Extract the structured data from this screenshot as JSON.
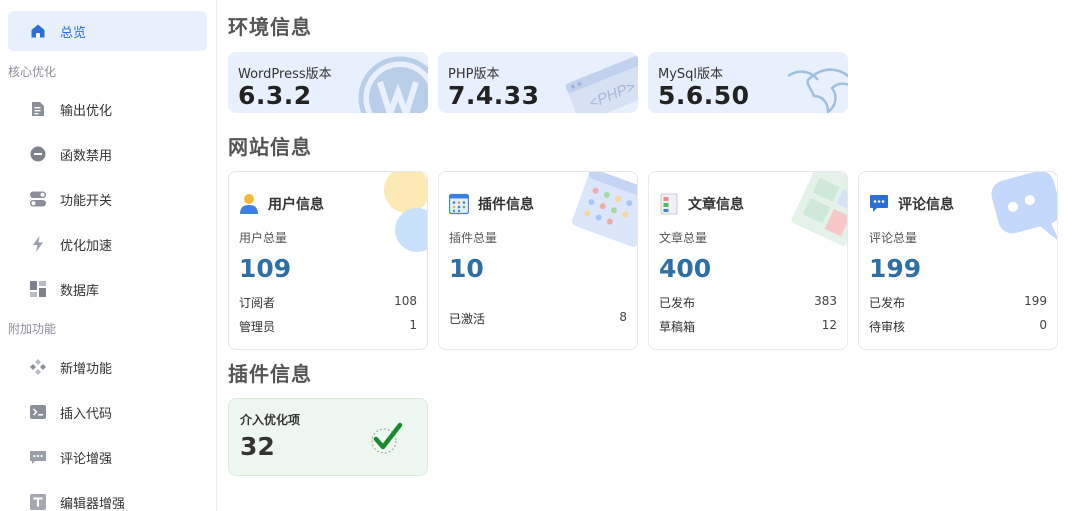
{
  "sidebar": {
    "active": {
      "label": "总览",
      "icon": "home-icon"
    },
    "groups": [
      {
        "title": "核心优化",
        "items": [
          {
            "label": "输出优化",
            "icon": "document-icon"
          },
          {
            "label": "函数禁用",
            "icon": "minus-circle-icon"
          },
          {
            "label": "功能开关",
            "icon": "toggle-icon"
          },
          {
            "label": "优化加速",
            "icon": "lightning-icon"
          },
          {
            "label": "数据库",
            "icon": "database-grid-icon"
          }
        ]
      },
      {
        "title": "附加功能",
        "items": [
          {
            "label": "新增功能",
            "icon": "diamond-icon"
          },
          {
            "label": "插入代码",
            "icon": "terminal-icon"
          },
          {
            "label": "评论增强",
            "icon": "comment-dots-icon"
          },
          {
            "label": "编辑器增强",
            "icon": "text-t-icon"
          }
        ]
      }
    ]
  },
  "env": {
    "title": "环境信息",
    "cards": [
      {
        "name": "WordPress版本",
        "version": "6.3.2",
        "icon": "wordpress-logo-icon"
      },
      {
        "name": "PHP版本",
        "version": "7.4.33",
        "icon": "php-logo-icon"
      },
      {
        "name": "MySql版本",
        "version": "5.6.50",
        "icon": "mysql-dolphin-icon"
      }
    ]
  },
  "site": {
    "title": "网站信息",
    "cards": [
      {
        "title": "用户信息",
        "subtitle": "用户总量",
        "total": "109",
        "rows": [
          {
            "label": "订阅者",
            "value": "108"
          },
          {
            "label": "管理员",
            "value": "1"
          }
        ]
      },
      {
        "title": "插件信息",
        "subtitle": "插件总量",
        "total": "10",
        "rows": [
          {
            "label": "已激活",
            "value": "8"
          }
        ]
      },
      {
        "title": "文章信息",
        "subtitle": "文章总量",
        "total": "400",
        "rows": [
          {
            "label": "已发布",
            "value": "383"
          },
          {
            "label": "草稿箱",
            "value": "12"
          }
        ]
      },
      {
        "title": "评论信息",
        "subtitle": "评论总量",
        "total": "199",
        "rows": [
          {
            "label": "已发布",
            "value": "199"
          },
          {
            "label": "待审核",
            "value": "0"
          }
        ]
      }
    ]
  },
  "plugin": {
    "title": "插件信息",
    "card": {
      "label": "介入优化项",
      "value": "32",
      "icon": "check-badge-icon"
    }
  },
  "colors": {
    "accent": "#2b6fd6",
    "number": "#2e6fa8",
    "env_bg": "#e9f0fd",
    "plugin_bg": "#eef7ef",
    "check": "#1a8a2e"
  }
}
